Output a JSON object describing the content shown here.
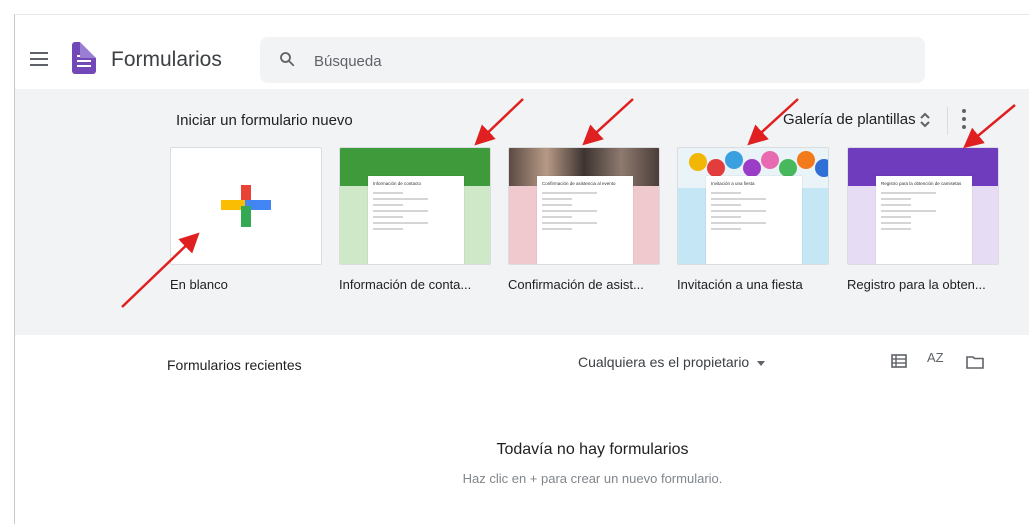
{
  "header": {
    "app_title": "Formularios",
    "search_placeholder": "Búsqueda"
  },
  "templates": {
    "section_title": "Iniciar un formulario nuevo",
    "gallery_label": "Galería de plantillas",
    "cards": [
      {
        "label": "En blanco"
      },
      {
        "label": "Información de conta...",
        "preview_title": "Información de contacto"
      },
      {
        "label": "Confirmación de asist...",
        "preview_title": "Confirmación de asistencia al evento"
      },
      {
        "label": "Invitación a una fiesta",
        "preview_title": "Invitación a una fiesta"
      },
      {
        "label": "Registro para la obten...",
        "preview_title": "Registro para la obtención de camisetas"
      }
    ]
  },
  "recent": {
    "title": "Formularios recientes",
    "owner_filter": "Cualquiera es el propietario",
    "sort_label": "AZ",
    "empty_title": "Todavía no hay formularios",
    "empty_subtitle": "Haz clic en + para crear un nuevo formulario."
  },
  "colors": {
    "accent": "#7248b9",
    "annotation_arrow": "#e02020",
    "band": "#f1f3f4"
  }
}
